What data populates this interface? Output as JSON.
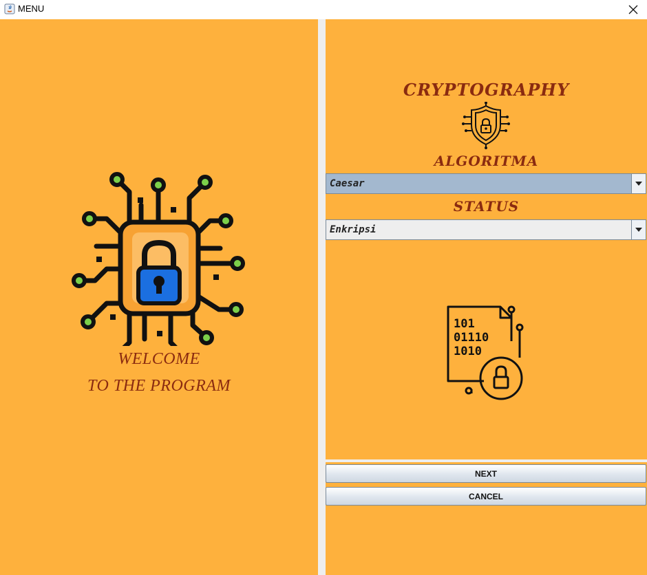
{
  "window": {
    "title": "MENU",
    "app_icon": "java-icon",
    "close_icon": "close-icon"
  },
  "left": {
    "logo_icon": "circuit-lock-icon",
    "welcome_line1": "WELCOME",
    "welcome_line2": "TO THE PROGRAM"
  },
  "right": {
    "title": "CRYPTOGRAPHY",
    "shield_icon": "shield-lock-icon",
    "algorithm_label": "ALGORITMA",
    "algorithm_value": "Caesar",
    "status_label": "STATUS",
    "status_value": "Enkripsi",
    "binary_icon": "binary-document-lock-icon",
    "binary_lines": [
      "101",
      "01110",
      "1010"
    ],
    "next_label": "NEXT",
    "cancel_label": "CANCEL"
  },
  "colors": {
    "background": "#feb13d",
    "title_text": "#8a2b10",
    "combo_selected": "#a3b8cf"
  }
}
